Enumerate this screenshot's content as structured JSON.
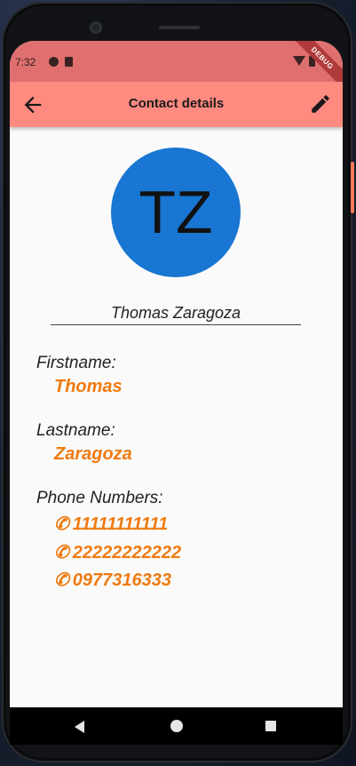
{
  "status": {
    "time": "7:32",
    "debug_banner": "DEBUG"
  },
  "appbar": {
    "title": "Contact details",
    "back_icon": "arrow-back-icon",
    "edit_icon": "edit-pencil-icon"
  },
  "avatar": {
    "initials": "TZ",
    "color": "#1976d2"
  },
  "contact": {
    "full_name": "Thomas Zaragoza",
    "firstname_label": "Firstname:",
    "firstname": "Thomas",
    "lastname_label": "Lastname:",
    "lastname": "Zaragoza",
    "phones_label": "Phone Numbers:",
    "phones": [
      "11111111111",
      "22222222222",
      "0977316333"
    ],
    "phone_glyph": "✆"
  },
  "colors": {
    "accent": "#f07a10",
    "appbar": "#ff8a80",
    "statusbar": "#e07070"
  }
}
